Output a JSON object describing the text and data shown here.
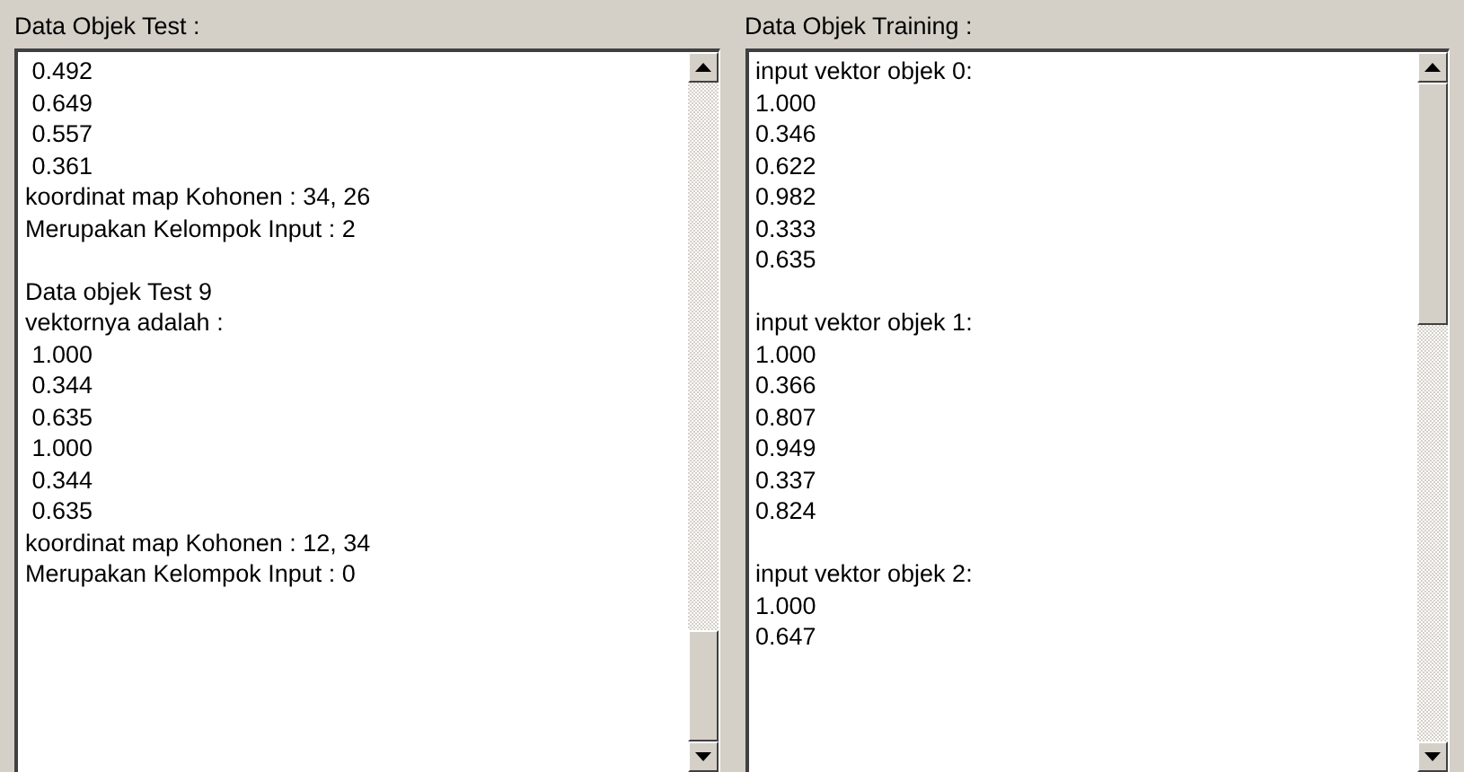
{
  "panels": [
    {
      "label": "Data Objek Test :",
      "blocks": [
        {
          "lines": [
            " 0.492",
            " 0.649",
            " 0.557",
            " 0.361",
            "koordinat map Kohonen : 34, 26",
            "Merupakan Kelompok Input : 2"
          ]
        },
        {
          "lines": [
            "Data objek Test 9",
            "vektornya adalah :",
            " 1.000",
            " 0.344",
            " 0.635",
            " 1.000",
            " 0.344",
            " 0.635",
            "koordinat map Kohonen : 12, 34",
            "Merupakan Kelompok Input : 0"
          ]
        }
      ]
    },
    {
      "label": "Data Objek Training :",
      "blocks": [
        {
          "lines": [
            "input vektor objek 0:",
            "1.000",
            "0.346",
            "0.622",
            "0.982",
            "0.333",
            "0.635"
          ]
        },
        {
          "lines": [
            "input vektor objek 1:",
            "1.000",
            "0.366",
            "0.807",
            "0.949",
            "0.337",
            "0.824"
          ]
        },
        {
          "lines": [
            "input vektor objek 2:",
            "1.000",
            "0.647"
          ]
        }
      ]
    }
  ]
}
